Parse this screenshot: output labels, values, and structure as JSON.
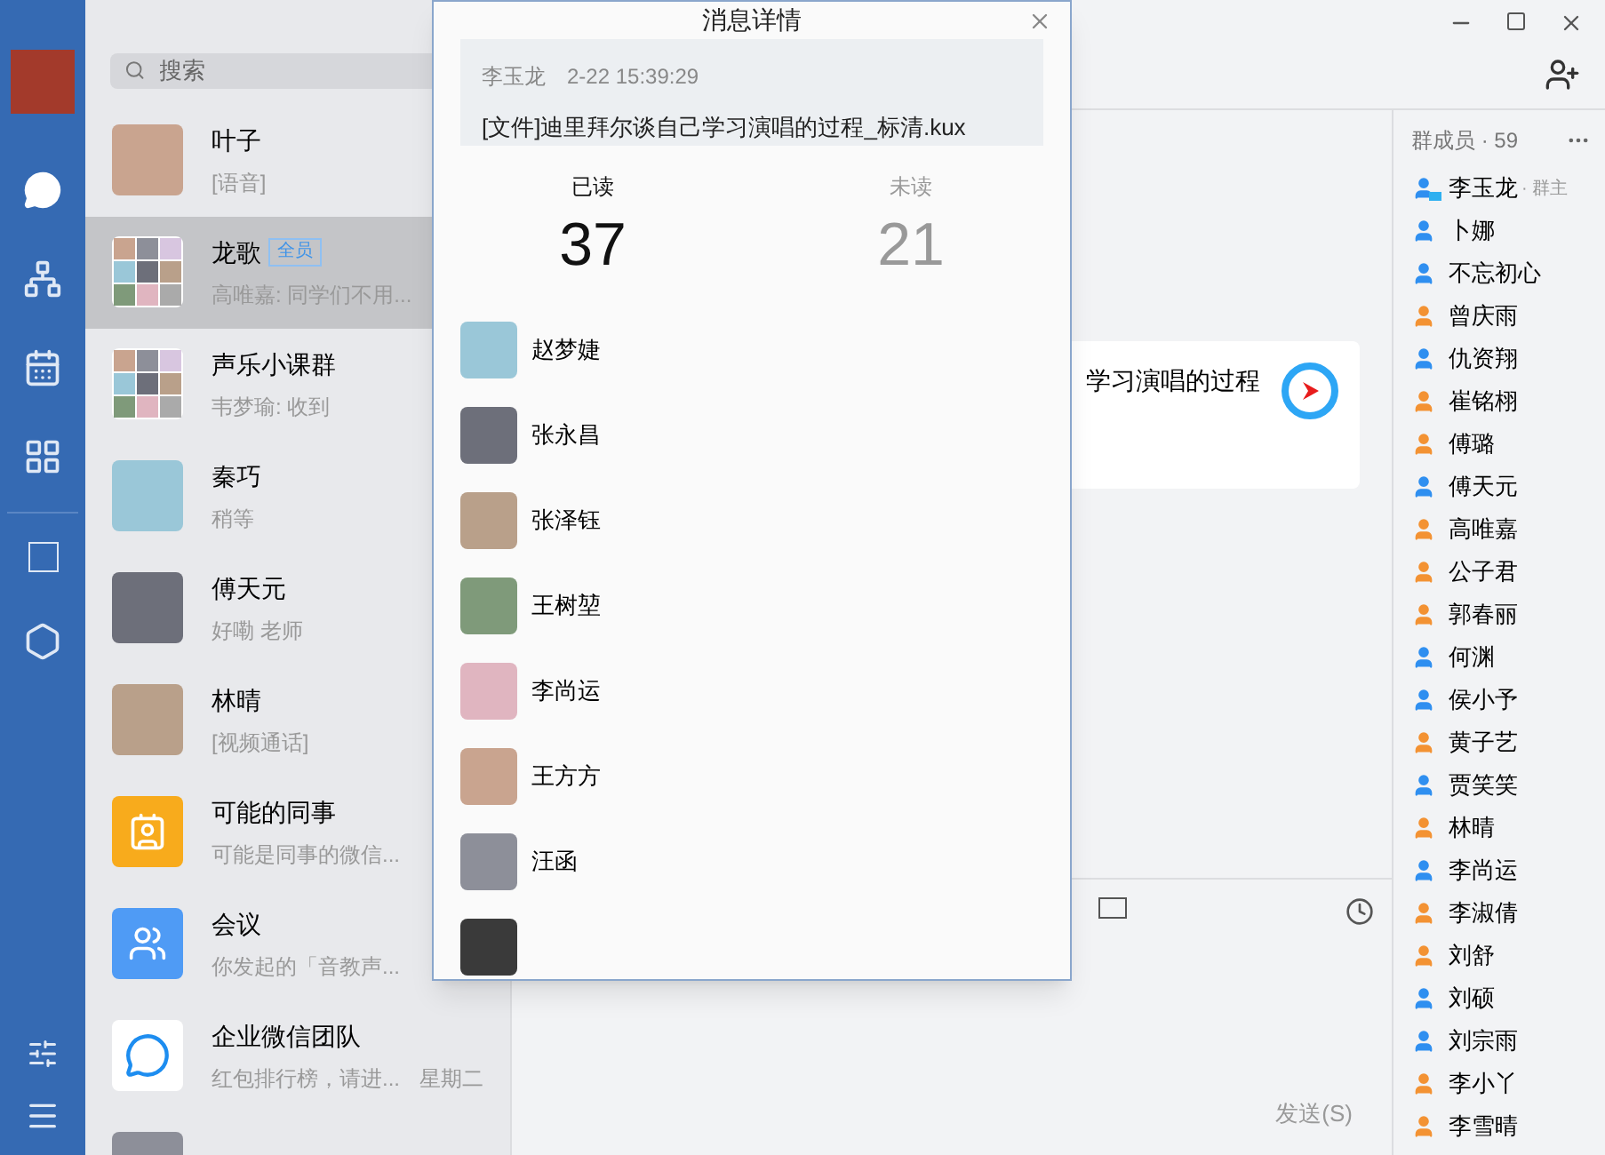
{
  "search": {
    "placeholder": "搜索"
  },
  "chats": [
    {
      "kind": "photo",
      "name": "叶子",
      "preview": "[语音]",
      "selected": false
    },
    {
      "kind": "grid",
      "name": "龙歌",
      "badge": "全员",
      "preview": "高唯嘉: 同学们不用...",
      "selected": true
    },
    {
      "kind": "grid",
      "name": "声乐小课群",
      "preview": "韦梦瑜: 收到",
      "selected": false
    },
    {
      "kind": "photo",
      "name": "秦巧",
      "preview": "稍等",
      "selected": false
    },
    {
      "kind": "photo",
      "name": "傅天元",
      "preview": "好嘞 老师",
      "selected": false
    },
    {
      "kind": "photo",
      "name": "林晴",
      "preview": "[视频通话]",
      "selected": false
    },
    {
      "kind": "colleagues",
      "name": "可能的同事",
      "preview": "可能是同事的微信...",
      "selected": false
    },
    {
      "kind": "meeting",
      "name": "会议",
      "preview": "你发起的「音教声...",
      "selected": false
    },
    {
      "kind": "team",
      "name": "企业微信团队",
      "preview": "红包排行榜，请进...",
      "time": "星期二",
      "selected": false
    },
    {
      "kind": "photo",
      "selected": false
    }
  ],
  "message_card": {
    "text": "学习演唱的过程"
  },
  "send_button": "发送(S)",
  "members": {
    "title": "群成员 · 59",
    "items": [
      {
        "name": "李玉龙",
        "role": "· 群主",
        "kind": "owner",
        "color": "#2f8ff0"
      },
      {
        "name": "卜娜",
        "color": "#2f8ff0"
      },
      {
        "name": "不忘初心",
        "color": "#2f8ff0"
      },
      {
        "name": "曾庆雨",
        "color": "#f39233"
      },
      {
        "name": "仇资翔",
        "color": "#2f8ff0"
      },
      {
        "name": "崔铭栩",
        "color": "#f39233"
      },
      {
        "name": "傅璐",
        "color": "#f39233"
      },
      {
        "name": "傅天元",
        "color": "#2f8ff0"
      },
      {
        "name": "高唯嘉",
        "color": "#f39233"
      },
      {
        "name": "公子君",
        "color": "#f39233"
      },
      {
        "name": "郭春丽",
        "color": "#f39233"
      },
      {
        "name": "何渊",
        "color": "#2f8ff0"
      },
      {
        "name": "侯小予",
        "color": "#2f8ff0"
      },
      {
        "name": "黄子艺",
        "color": "#f39233"
      },
      {
        "name": "贾笑笑",
        "color": "#2f8ff0"
      },
      {
        "name": "林晴",
        "color": "#f39233"
      },
      {
        "name": "李尚运",
        "color": "#2f8ff0"
      },
      {
        "name": "李淑倩",
        "color": "#f39233"
      },
      {
        "name": "刘舒",
        "color": "#f39233"
      },
      {
        "name": "刘硕",
        "color": "#2f8ff0"
      },
      {
        "name": "刘宗雨",
        "color": "#2f8ff0"
      },
      {
        "name": "李小丫",
        "color": "#f39233"
      },
      {
        "name": "李雪晴",
        "color": "#f39233"
      }
    ]
  },
  "dialog": {
    "title": "消息详情",
    "sender": "李玉龙",
    "time": "2-22 15:39:29",
    "message": "[文件]迪里拜尔谈自己学习演唱的过程_标清.kux",
    "tabs": [
      {
        "label": "已读",
        "count": "37",
        "selected": true
      },
      {
        "label": "未读",
        "count": "21",
        "selected": false
      }
    ],
    "readers": [
      {
        "name": "赵梦婕"
      },
      {
        "name": "张永昌"
      },
      {
        "name": "张泽钰"
      },
      {
        "name": "王树堃"
      },
      {
        "name": "李尚运"
      },
      {
        "name": "王方方"
      },
      {
        "name": "汪函"
      }
    ],
    "more_below": true
  }
}
